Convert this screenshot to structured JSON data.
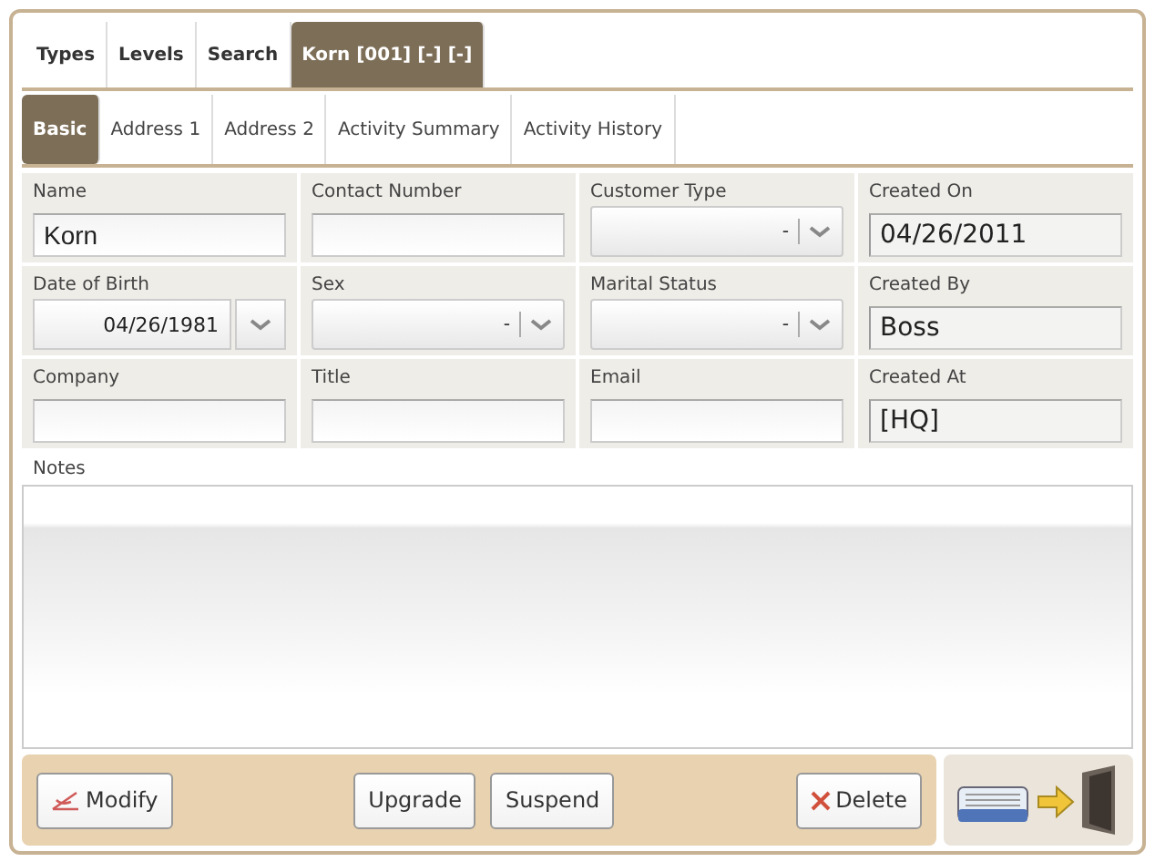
{
  "tabs": [
    {
      "label": "Types",
      "selected": false
    },
    {
      "label": "Levels",
      "selected": false
    },
    {
      "label": "Search",
      "selected": false
    },
    {
      "label": "Korn [001] [-] [-]",
      "selected": true
    }
  ],
  "subtabs": [
    {
      "label": "Basic",
      "selected": true
    },
    {
      "label": "Address 1",
      "selected": false
    },
    {
      "label": "Address 2",
      "selected": false
    },
    {
      "label": "Activity Summary",
      "selected": false
    },
    {
      "label": "Activity History",
      "selected": false
    }
  ],
  "fields": [
    {
      "label": "Name",
      "kind": "text",
      "value": "Korn"
    },
    {
      "label": "Contact Number",
      "kind": "text"
    },
    {
      "label": "Customer Type",
      "kind": "select",
      "value": "-"
    },
    {
      "label": "Created On",
      "kind": "readonly",
      "value": "04/26/2011"
    },
    {
      "label": "Date of Birth",
      "kind": "date",
      "value": "04/26/1981"
    },
    {
      "label": "Sex",
      "kind": "select",
      "value": "-"
    },
    {
      "label": "Marital Status",
      "kind": "select",
      "value": "-"
    },
    {
      "label": "Created By",
      "kind": "readonly",
      "value": "Boss"
    },
    {
      "label": "Company",
      "kind": "text"
    },
    {
      "label": "Title",
      "kind": "text"
    },
    {
      "label": "Email",
      "kind": "text"
    },
    {
      "label": "Created At",
      "kind": "readonly",
      "value": "[HQ]"
    }
  ],
  "notes": {
    "label": "Notes"
  },
  "buttons": [
    {
      "label": "Modify",
      "kind": "modify"
    },
    {
      "label": "Upgrade",
      "kind": "plain"
    },
    {
      "label": "Suspend",
      "kind": "plain"
    },
    {
      "label": "Delete",
      "kind": "delete"
    }
  ]
}
